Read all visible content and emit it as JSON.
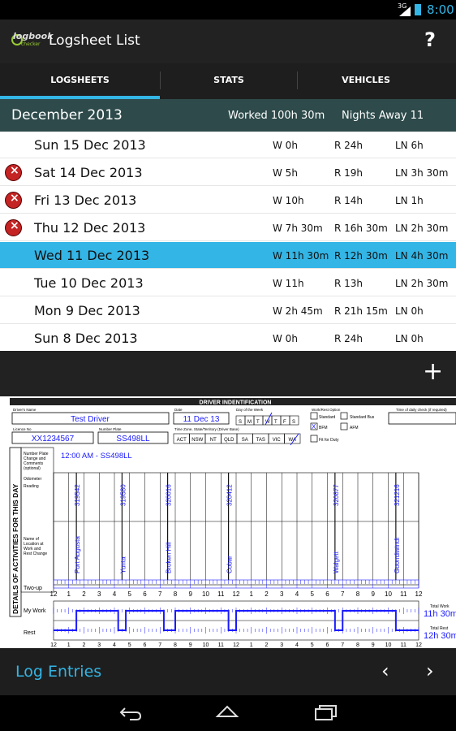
{
  "status_bar": {
    "network": "3G",
    "time": "8:00"
  },
  "action_bar": {
    "title": "Logsheet List",
    "logo_text": "logbook",
    "logo_sub": "checker",
    "help": "?"
  },
  "tabs": [
    {
      "label": "LOGSHEETS",
      "active": true
    },
    {
      "label": "STATS",
      "active": false
    },
    {
      "label": "VEHICLES",
      "active": false
    }
  ],
  "month_header": {
    "month": "December 2013",
    "worked": "Worked 100h 30m",
    "nights_away": "Nights Away 11"
  },
  "logsheets": [
    {
      "date": "Sun 15 Dec 2013",
      "work": "W 0h",
      "rest": "R 24h",
      "ln": "LN 6h",
      "error": false,
      "selected": false
    },
    {
      "date": "Sat 14 Dec 2013",
      "work": "W 5h",
      "rest": "R 19h",
      "ln": "LN 3h 30m",
      "error": true,
      "selected": false
    },
    {
      "date": "Fri 13 Dec 2013",
      "work": "W 10h",
      "rest": "R 14h",
      "ln": "LN 1h",
      "error": true,
      "selected": false
    },
    {
      "date": "Thu 12 Dec 2013",
      "work": "W 7h 30m",
      "rest": "R 16h 30m",
      "ln": "LN 2h 30m",
      "error": true,
      "selected": false
    },
    {
      "date": "Wed 11 Dec 2013",
      "work": "W 11h 30m",
      "rest": "R 12h 30m",
      "ln": "LN 4h 30m",
      "error": false,
      "selected": true
    },
    {
      "date": "Tue 10 Dec 2013",
      "work": "W 11h",
      "rest": "R 13h",
      "ln": "LN 2h 30m",
      "error": false,
      "selected": false
    },
    {
      "date": "Mon 9 Dec 2013",
      "work": "W 2h 45m",
      "rest": "R 21h 15m",
      "ln": "LN 0h",
      "error": false,
      "selected": false
    },
    {
      "date": "Sun 8 Dec 2013",
      "work": "W 0h",
      "rest": "R 24h",
      "ln": "LN 0h",
      "error": false,
      "selected": false
    }
  ],
  "add_button": "+",
  "log_sheet": {
    "section_title": "DRIVER INDENTIFICATION",
    "drivers_name_label": "Driver's Name",
    "drivers_name": "Test Driver",
    "date_label": "Date",
    "date": "11 Dec 13",
    "dow_label": "Day of the Week",
    "dow_letters": [
      "S",
      "M",
      "T",
      "W",
      "T",
      "F",
      "S"
    ],
    "work_rest_label": "Work/Rest Option",
    "options": [
      "Standard",
      "Standard Bus",
      "BFM",
      "AFM"
    ],
    "fit_for_duty": "Fit for Duty",
    "time_check_label": "Time of daily check (if required)",
    "licence_label": "Licence No",
    "licence": "XX1234567",
    "plate_label": "Number Plate",
    "plate": "SS498LL",
    "zone_label": "Time Zone, State/Territory (Driver Base)",
    "states": [
      "ACT",
      "NSW",
      "NT",
      "QLD",
      "SA",
      "TAS",
      "VIC",
      "WA"
    ],
    "side_title": "DETAILS OF ACTIVITIES FOR THIS DAY",
    "plate_change_label": "Number Plate Change and Comments (optional)",
    "plate_change_note": "e.g. drivers authorised changes",
    "plate_change_value": "12:00 AM - SS498LL",
    "odometer_label": "Odometer Reading",
    "odometers": [
      "319542",
      "319580",
      "320016",
      "320412",
      "320877",
      "321216"
    ],
    "location_label": "Name of Location at Work and Rest Change",
    "locations": [
      "Port Augusta",
      "Yunta",
      "Broken Hill",
      "Cobar",
      "Walgett",
      "Goondiwindi"
    ],
    "two_up": "Two-up",
    "hours": [
      "12",
      "1",
      "2",
      "3",
      "4",
      "5",
      "6",
      "7",
      "8",
      "9",
      "10",
      "11",
      "12",
      "1",
      "2",
      "3",
      "4",
      "5",
      "6",
      "7",
      "8",
      "9",
      "10",
      "11",
      "12"
    ],
    "my_work": "My Work",
    "rest": "Rest",
    "total_work_label": "Total Work",
    "total_work": "11h 30m",
    "total_rest_label": "Total Rest",
    "total_rest": "12h 30m",
    "odometer_note": "Odometer entries not be mandatory",
    "all_time_note": "All times rounded to 15m"
  },
  "bottom_bar": {
    "title": "Log Entries",
    "prev": "‹",
    "next": "›"
  },
  "colors": {
    "accent": "#33b5e5",
    "month_bg": "#2e4a4a",
    "error": "#c42424",
    "ink": "#1a1aff"
  }
}
